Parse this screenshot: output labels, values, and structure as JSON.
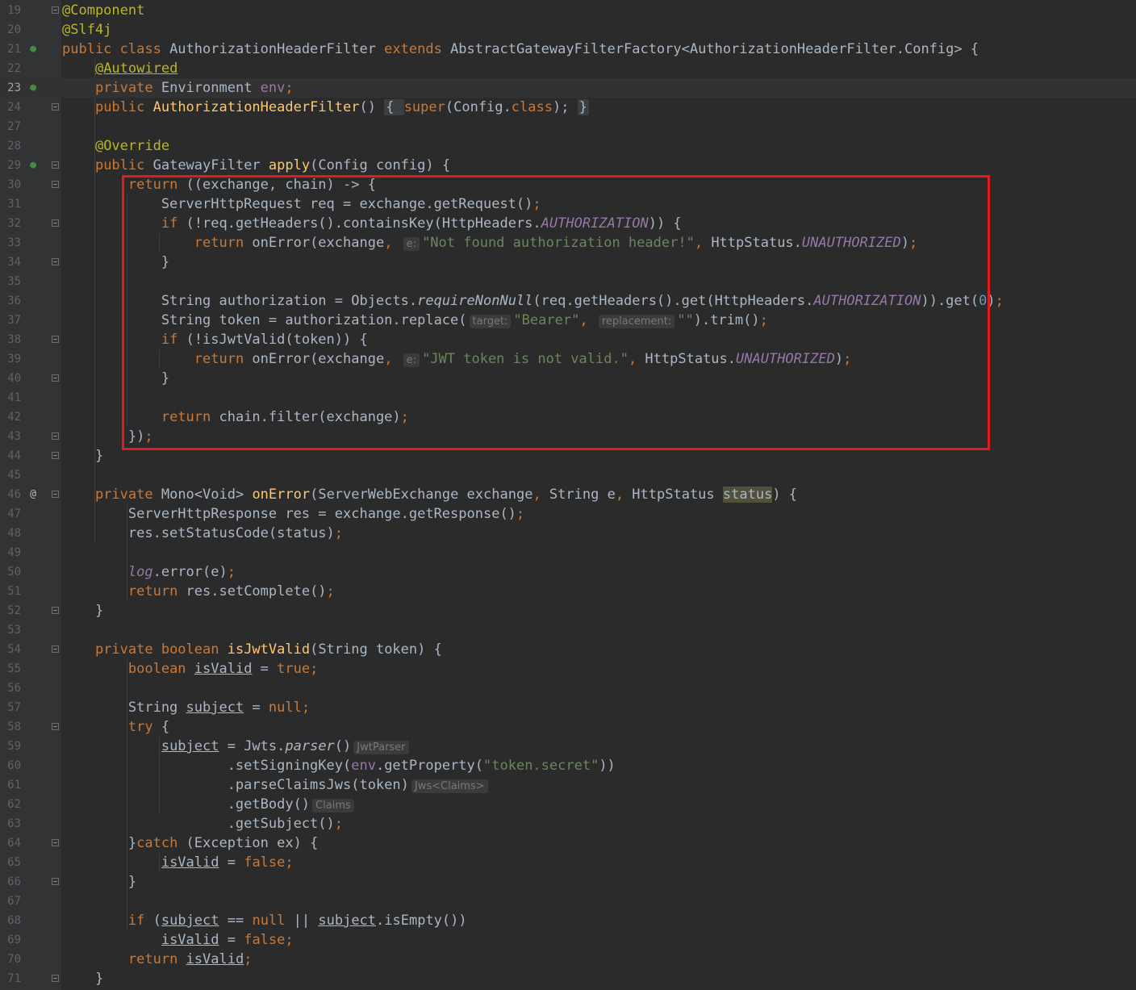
{
  "editor": {
    "language": "java",
    "lines": [
      {
        "n": "19",
        "icon": "",
        "fold": true,
        "segs": [
          [
            "ann",
            "@Component"
          ]
        ]
      },
      {
        "n": "20",
        "icon": "",
        "fold": false,
        "segs": [
          [
            "ann",
            "@Slf4j"
          ]
        ]
      },
      {
        "n": "21",
        "icon": "bean-icon",
        "fold": false,
        "segs": [
          [
            "kw",
            "public class "
          ],
          [
            "",
            "AuthorizationHeaderFilter "
          ],
          [
            "kw",
            "extends "
          ],
          [
            "",
            "AbstractGatewayFilterFactory<AuthorizationHeaderFilter.Config> {"
          ]
        ]
      },
      {
        "n": "22",
        "icon": "",
        "fold": false,
        "segs": [
          [
            "",
            "    "
          ],
          [
            "ann ul",
            "@Autowired"
          ]
        ]
      },
      {
        "n": "23",
        "icon": "autowired-icon",
        "fold": false,
        "current": true,
        "segs": [
          [
            "",
            "    "
          ],
          [
            "kw",
            "private "
          ],
          [
            "",
            "Environment "
          ],
          [
            "fld",
            "env"
          ],
          [
            "kw",
            ";"
          ]
        ]
      },
      {
        "n": "24",
        "icon": "",
        "fold": true,
        "segs": [
          [
            "",
            "    "
          ],
          [
            "kw",
            "public "
          ],
          [
            "fn",
            "AuthorizationHeaderFilter"
          ],
          [
            "",
            "() "
          ],
          [
            "foldbox",
            "{ "
          ],
          [
            "kw",
            "super"
          ],
          [
            "",
            "(Config."
          ],
          [
            "kw",
            "class"
          ],
          [
            "",
            "); "
          ],
          [
            "foldbox",
            "}"
          ]
        ]
      },
      {
        "n": "27",
        "icon": "",
        "fold": false,
        "segs": []
      },
      {
        "n": "28",
        "icon": "",
        "fold": false,
        "segs": [
          [
            "",
            "    "
          ],
          [
            "ann",
            "@Override"
          ]
        ]
      },
      {
        "n": "29",
        "icon": "override-icon",
        "fold": true,
        "segs": [
          [
            "",
            "    "
          ],
          [
            "kw",
            "public "
          ],
          [
            "",
            "GatewayFilter "
          ],
          [
            "fn",
            "apply"
          ],
          [
            "",
            "(Config config) {"
          ]
        ]
      },
      {
        "n": "30",
        "icon": "",
        "fold": true,
        "segs": [
          [
            "",
            "        "
          ],
          [
            "kw",
            "return "
          ],
          [
            "",
            "((exchange, chain) -> {"
          ]
        ]
      },
      {
        "n": "31",
        "icon": "",
        "fold": false,
        "segs": [
          [
            "",
            "            ServerHttpRequest req = exchange.getRequest()"
          ],
          [
            "kw",
            ";"
          ]
        ]
      },
      {
        "n": "32",
        "icon": "",
        "fold": true,
        "segs": [
          [
            "",
            "            "
          ],
          [
            "kw",
            "if "
          ],
          [
            "",
            "(!req.getHeaders().containsKey(HttpHeaders."
          ],
          [
            "cst",
            "AUTHORIZATION"
          ],
          [
            "",
            ")) {"
          ]
        ]
      },
      {
        "n": "33",
        "icon": "",
        "fold": false,
        "segs": [
          [
            "",
            "                "
          ],
          [
            "kw",
            "return "
          ],
          [
            "",
            "onError(exchange"
          ],
          [
            "kw",
            ", "
          ],
          [
            "hint",
            "e:"
          ],
          [
            "str",
            "\"Not found authorization header!\""
          ],
          [
            "kw",
            ", "
          ],
          [
            "",
            "HttpStatus."
          ],
          [
            "cst",
            "UNAUTHORIZED"
          ],
          [
            "",
            ")"
          ],
          [
            "kw",
            ";"
          ]
        ]
      },
      {
        "n": "34",
        "icon": "",
        "fold": true,
        "segs": [
          [
            "",
            "            }"
          ]
        ]
      },
      {
        "n": "35",
        "icon": "",
        "fold": false,
        "segs": []
      },
      {
        "n": "36",
        "icon": "",
        "fold": false,
        "segs": [
          [
            "",
            "            String authorization = Objects."
          ],
          [
            "it",
            "requireNonNull"
          ],
          [
            "",
            "(req.getHeaders().get(HttpHeaders."
          ],
          [
            "cst",
            "AUTHORIZATION"
          ],
          [
            "",
            ")).get("
          ],
          [
            "num",
            "0"
          ],
          [
            "",
            ")"
          ],
          [
            "kw",
            ";"
          ]
        ]
      },
      {
        "n": "37",
        "icon": "",
        "fold": false,
        "segs": [
          [
            "",
            "            String token = authorization.replace("
          ],
          [
            "hint",
            "target:"
          ],
          [
            "str",
            "\"Bearer\""
          ],
          [
            "kw",
            ", "
          ],
          [
            "hint",
            "replacement:"
          ],
          [
            "str",
            "\"\""
          ],
          [
            "",
            ").trim()"
          ],
          [
            "kw",
            ";"
          ]
        ]
      },
      {
        "n": "38",
        "icon": "",
        "fold": true,
        "segs": [
          [
            "",
            "            "
          ],
          [
            "kw",
            "if "
          ],
          [
            "",
            "(!isJwtValid(token)) {"
          ]
        ]
      },
      {
        "n": "39",
        "icon": "",
        "fold": false,
        "segs": [
          [
            "",
            "                "
          ],
          [
            "kw",
            "return "
          ],
          [
            "",
            "onError(exchange"
          ],
          [
            "kw",
            ", "
          ],
          [
            "hint",
            "e:"
          ],
          [
            "str",
            "\"JWT token is not valid.\""
          ],
          [
            "kw",
            ", "
          ],
          [
            "",
            "HttpStatus."
          ],
          [
            "cst",
            "UNAUTHORIZED"
          ],
          [
            "",
            ")"
          ],
          [
            "kw",
            ";"
          ]
        ]
      },
      {
        "n": "40",
        "icon": "",
        "fold": true,
        "segs": [
          [
            "",
            "            }"
          ]
        ]
      },
      {
        "n": "41",
        "icon": "",
        "fold": false,
        "segs": []
      },
      {
        "n": "42",
        "icon": "",
        "fold": false,
        "segs": [
          [
            "",
            "            "
          ],
          [
            "kw",
            "return "
          ],
          [
            "",
            "chain.filter(exchange)"
          ],
          [
            "kw",
            ";"
          ]
        ]
      },
      {
        "n": "43",
        "icon": "",
        "fold": true,
        "segs": [
          [
            "",
            "        })"
          ],
          [
            "kw",
            ";"
          ]
        ]
      },
      {
        "n": "44",
        "icon": "",
        "fold": true,
        "segs": [
          [
            "",
            "    }"
          ]
        ]
      },
      {
        "n": "45",
        "icon": "",
        "fold": false,
        "segs": []
      },
      {
        "n": "46",
        "icon": "at-icon",
        "fold": true,
        "segs": [
          [
            "",
            "    "
          ],
          [
            "kw",
            "private "
          ],
          [
            "",
            "Mono<Void> "
          ],
          [
            "fn",
            "onError"
          ],
          [
            "",
            "(ServerWebExchange exchange"
          ],
          [
            "kw",
            ", "
          ],
          [
            "",
            "String e"
          ],
          [
            "kw",
            ", "
          ],
          [
            "",
            "HttpStatus "
          ],
          [
            "hl",
            "status"
          ],
          [
            "",
            ") {"
          ]
        ]
      },
      {
        "n": "47",
        "icon": "",
        "fold": false,
        "segs": [
          [
            "",
            "        ServerHttpResponse res = exchange.getResponse()"
          ],
          [
            "kw",
            ";"
          ]
        ]
      },
      {
        "n": "48",
        "icon": "",
        "fold": false,
        "segs": [
          [
            "",
            "        res.setStatusCode(status)"
          ],
          [
            "kw",
            ";"
          ]
        ]
      },
      {
        "n": "49",
        "icon": "",
        "fold": false,
        "segs": []
      },
      {
        "n": "50",
        "icon": "",
        "fold": false,
        "segs": [
          [
            "",
            "        "
          ],
          [
            "fld it",
            "log"
          ],
          [
            "",
            ".error(e)"
          ],
          [
            "kw",
            ";"
          ]
        ]
      },
      {
        "n": "51",
        "icon": "",
        "fold": false,
        "segs": [
          [
            "",
            "        "
          ],
          [
            "kw",
            "return "
          ],
          [
            "",
            "res.setComplete()"
          ],
          [
            "kw",
            ";"
          ]
        ]
      },
      {
        "n": "52",
        "icon": "",
        "fold": true,
        "segs": [
          [
            "",
            "    }"
          ]
        ]
      },
      {
        "n": "53",
        "icon": "",
        "fold": false,
        "segs": []
      },
      {
        "n": "54",
        "icon": "",
        "fold": true,
        "segs": [
          [
            "",
            "    "
          ],
          [
            "kw",
            "private boolean "
          ],
          [
            "fn",
            "isJwtValid"
          ],
          [
            "",
            "(String token) {"
          ]
        ]
      },
      {
        "n": "55",
        "icon": "",
        "fold": false,
        "segs": [
          [
            "",
            "        "
          ],
          [
            "kw",
            "boolean "
          ],
          [
            "ul",
            "isValid"
          ],
          [
            "",
            " = "
          ],
          [
            "kw",
            "true;"
          ]
        ]
      },
      {
        "n": "56",
        "icon": "",
        "fold": false,
        "segs": []
      },
      {
        "n": "57",
        "icon": "",
        "fold": false,
        "segs": [
          [
            "",
            "        String "
          ],
          [
            "ul",
            "subject"
          ],
          [
            "",
            " = "
          ],
          [
            "kw",
            "null;"
          ]
        ]
      },
      {
        "n": "58",
        "icon": "",
        "fold": true,
        "segs": [
          [
            "",
            "        "
          ],
          [
            "kw",
            "try "
          ],
          [
            "",
            "{"
          ]
        ]
      },
      {
        "n": "59",
        "icon": "",
        "fold": false,
        "segs": [
          [
            "",
            "            "
          ],
          [
            "ul",
            "subject"
          ],
          [
            "",
            " = Jwts."
          ],
          [
            "it",
            "parser"
          ],
          [
            "",
            "()"
          ],
          [
            "hint",
            "JwtParser"
          ]
        ]
      },
      {
        "n": "60",
        "icon": "",
        "fold": false,
        "segs": [
          [
            "",
            "                    .setSigningKey("
          ],
          [
            "fld",
            "env"
          ],
          [
            "",
            ".getProperty("
          ],
          [
            "str",
            "\"token.secret\""
          ],
          [
            "",
            "))"
          ]
        ]
      },
      {
        "n": "61",
        "icon": "",
        "fold": false,
        "segs": [
          [
            "",
            "                    .parseClaimsJws(token)"
          ],
          [
            "hint",
            "Jws<Claims>"
          ]
        ]
      },
      {
        "n": "62",
        "icon": "",
        "fold": false,
        "segs": [
          [
            "",
            "                    .getBody()"
          ],
          [
            "hint",
            "Claims"
          ]
        ]
      },
      {
        "n": "63",
        "icon": "",
        "fold": false,
        "segs": [
          [
            "",
            "                    .getSubject()"
          ],
          [
            "kw",
            ";"
          ]
        ]
      },
      {
        "n": "64",
        "icon": "",
        "fold": true,
        "segs": [
          [
            "",
            "        }"
          ],
          [
            "kw",
            "catch "
          ],
          [
            "",
            "(Exception ex) {"
          ]
        ]
      },
      {
        "n": "65",
        "icon": "",
        "fold": false,
        "segs": [
          [
            "",
            "            "
          ],
          [
            "ul",
            "isValid"
          ],
          [
            "",
            " = "
          ],
          [
            "kw",
            "false;"
          ]
        ]
      },
      {
        "n": "66",
        "icon": "",
        "fold": true,
        "segs": [
          [
            "",
            "        }"
          ]
        ]
      },
      {
        "n": "67",
        "icon": "",
        "fold": false,
        "segs": []
      },
      {
        "n": "68",
        "icon": "",
        "fold": false,
        "segs": [
          [
            "",
            "        "
          ],
          [
            "kw",
            "if "
          ],
          [
            "",
            "("
          ],
          [
            "ul",
            "subject"
          ],
          [
            "",
            " == "
          ],
          [
            "kw",
            "null "
          ],
          [
            "",
            "|| "
          ],
          [
            "ul",
            "subject"
          ],
          [
            "",
            ".isEmpty())"
          ]
        ]
      },
      {
        "n": "69",
        "icon": "",
        "fold": false,
        "segs": [
          [
            "",
            "            "
          ],
          [
            "ul",
            "isValid"
          ],
          [
            "",
            " = "
          ],
          [
            "kw",
            "false;"
          ]
        ]
      },
      {
        "n": "70",
        "icon": "",
        "fold": false,
        "segs": [
          [
            "",
            "        "
          ],
          [
            "kw",
            "return "
          ],
          [
            "ul",
            "isValid"
          ],
          [
            "kw",
            ";"
          ]
        ]
      },
      {
        "n": "71",
        "icon": "",
        "fold": true,
        "segs": [
          [
            "",
            "    }"
          ]
        ]
      }
    ]
  },
  "gutter_icon_glyphs": {
    "bean-icon": "●",
    "autowired-icon": "●",
    "override-icon": "●",
    "at-icon": "@"
  },
  "colors": {
    "background": "#2b2b2b",
    "keyword": "#cc7832",
    "annotation": "#bbb529",
    "method": "#ffc66d",
    "string": "#6a8759",
    "number": "#6897bb",
    "constant": "#9876aa",
    "highlight_box": "#e31b1b"
  }
}
